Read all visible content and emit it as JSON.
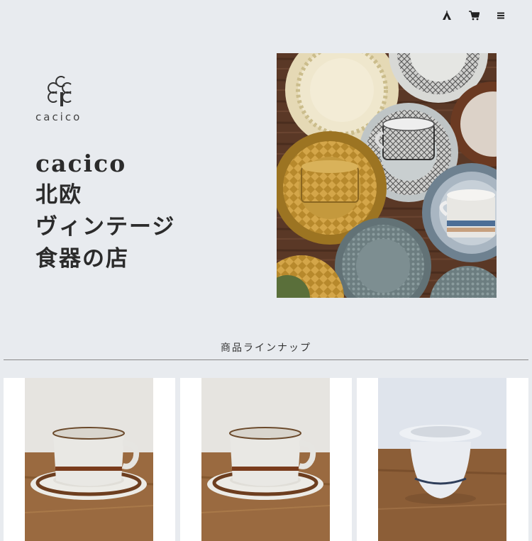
{
  "header": {
    "icons": [
      "tent-icon",
      "cart-icon",
      "menu-icon"
    ]
  },
  "logo": {
    "text": "cacico"
  },
  "hero": {
    "lines": [
      "cacico",
      "北欧",
      "ヴィンテージ",
      "食器の店"
    ],
    "photo_icon": "vintage-tableware-photo"
  },
  "section": {
    "title": "商品ラインナップ"
  },
  "products": [
    {
      "image": "coffee-cup-saucer-photo"
    },
    {
      "image": "coffee-cup-saucer-photo"
    },
    {
      "image": "egg-cup-photo"
    }
  ],
  "colors": {
    "background": "#e8ebef",
    "text": "#2b2b2b",
    "card": "#ffffff",
    "wood": "#9a6a40"
  }
}
